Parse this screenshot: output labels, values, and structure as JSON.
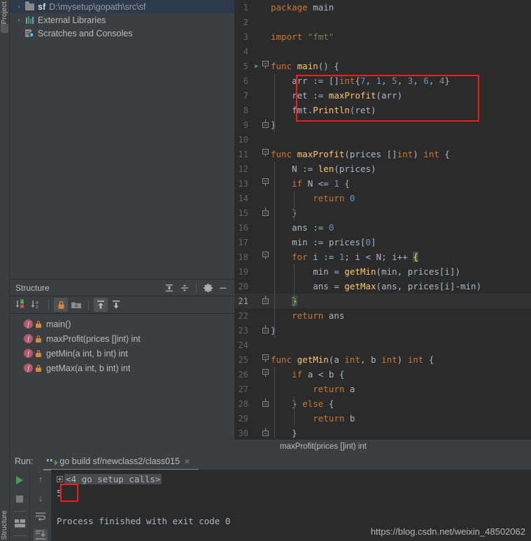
{
  "window": {
    "left_strip_label": "1: Project",
    "bottom_strip_label": "Structure"
  },
  "project": {
    "items": [
      {
        "chevron": "›",
        "icon": "folder-icon",
        "name": "sf",
        "path": "D:\\mysetup\\gopath\\src\\sf",
        "selected": true
      },
      {
        "chevron": "›",
        "icon": "library-icon",
        "name": "External Libraries",
        "path": "",
        "selected": false
      },
      {
        "chevron": "",
        "icon": "scratches-icon",
        "name": "Scratches and Consoles",
        "path": "",
        "selected": false
      }
    ]
  },
  "structure": {
    "title": "Structure",
    "header_icons": [
      "expand-all-icon",
      "collapse-all-icon",
      "settings-gear-icon",
      "hide-minimize-icon"
    ],
    "toolbar_icons": [
      "sort-by-visibility-icon",
      "sort-alphabetically-icon",
      "show-non-public-icon",
      "group-by-file-icon",
      "show-inherited-icon",
      "show-anonymous-icon"
    ],
    "items": [
      {
        "kind": "f",
        "label": "main()"
      },
      {
        "kind": "f",
        "label": "maxProfit(prices []int) int"
      },
      {
        "kind": "f",
        "label": "getMin(a int, b int) int"
      },
      {
        "kind": "f",
        "label": "getMax(a int, b int) int"
      }
    ]
  },
  "editor": {
    "breadcrumb": "maxProfit(prices []int) int",
    "lines": [
      {
        "n": "1",
        "indent": 0,
        "text": "package main"
      },
      {
        "n": "2",
        "indent": 0,
        "text": ""
      },
      {
        "n": "3",
        "indent": 0,
        "text": "import \"fmt\""
      },
      {
        "n": "4",
        "indent": 0,
        "text": ""
      },
      {
        "n": "5",
        "indent": 0,
        "text": "func main() {"
      },
      {
        "n": "6",
        "indent": 1,
        "text": "arr := []int{7, 1, 5, 3, 6, 4}"
      },
      {
        "n": "7",
        "indent": 1,
        "text": "ret := maxProfit(arr)"
      },
      {
        "n": "8",
        "indent": 1,
        "text": "fmt.Println(ret)"
      },
      {
        "n": "9",
        "indent": 0,
        "text": "}"
      },
      {
        "n": "10",
        "indent": 0,
        "text": ""
      },
      {
        "n": "11",
        "indent": 0,
        "text": "func maxProfit(prices []int) int {"
      },
      {
        "n": "12",
        "indent": 1,
        "text": "N := len(prices)"
      },
      {
        "n": "13",
        "indent": 1,
        "text": "if N <= 1 {"
      },
      {
        "n": "14",
        "indent": 2,
        "text": "return 0"
      },
      {
        "n": "15",
        "indent": 1,
        "text": "}"
      },
      {
        "n": "16",
        "indent": 1,
        "text": "ans := 0"
      },
      {
        "n": "17",
        "indent": 1,
        "text": "min := prices[0]"
      },
      {
        "n": "18",
        "indent": 1,
        "text": "for i := 1; i < N; i++ {"
      },
      {
        "n": "19",
        "indent": 2,
        "text": "min = getMin(min, prices[i])"
      },
      {
        "n": "20",
        "indent": 2,
        "text": "ans = getMax(ans, prices[i]-min)"
      },
      {
        "n": "21",
        "indent": 1,
        "text": "}"
      },
      {
        "n": "22",
        "indent": 1,
        "text": "return ans"
      },
      {
        "n": "23",
        "indent": 0,
        "text": "}"
      },
      {
        "n": "24",
        "indent": 0,
        "text": ""
      },
      {
        "n": "25",
        "indent": 0,
        "text": "func getMin(a int, b int) int {"
      },
      {
        "n": "26",
        "indent": 1,
        "text": "if a < b {"
      },
      {
        "n": "27",
        "indent": 2,
        "text": "return a"
      },
      {
        "n": "28",
        "indent": 1,
        "text": "} else {"
      },
      {
        "n": "29",
        "indent": 2,
        "text": "return b"
      },
      {
        "n": "30",
        "indent": 1,
        "text": "}"
      }
    ],
    "current_line": "21",
    "run_gutter_line": "5"
  },
  "run": {
    "label": "Run:",
    "tab_title": "go build sf/newclass2/class015",
    "tab_close": "×",
    "console": {
      "setup_calls": "<4 go setup calls>",
      "output": "5",
      "finished": "Process finished with exit code 0"
    },
    "side_icons": [
      "run-icon",
      "stop-icon",
      "layout-icon",
      "scroll-up-icon",
      "scroll-down-icon",
      "soft-wrap-icon",
      "scroll-to-end-icon"
    ]
  },
  "watermark": "https://blog.csdn.net/weixin_48502062",
  "colors": {
    "accent_selection": "#2d3a4c",
    "keyword": "#cc7832",
    "string": "#6a8759",
    "number": "#6897bb",
    "function": "#ffc66d",
    "default_text": "#a9b7c6",
    "editor_bg": "#2b2b2b",
    "panel_bg": "#3c3f41",
    "highlight_box": "#f01f1f",
    "brace_match_bg": "#3b514d"
  }
}
